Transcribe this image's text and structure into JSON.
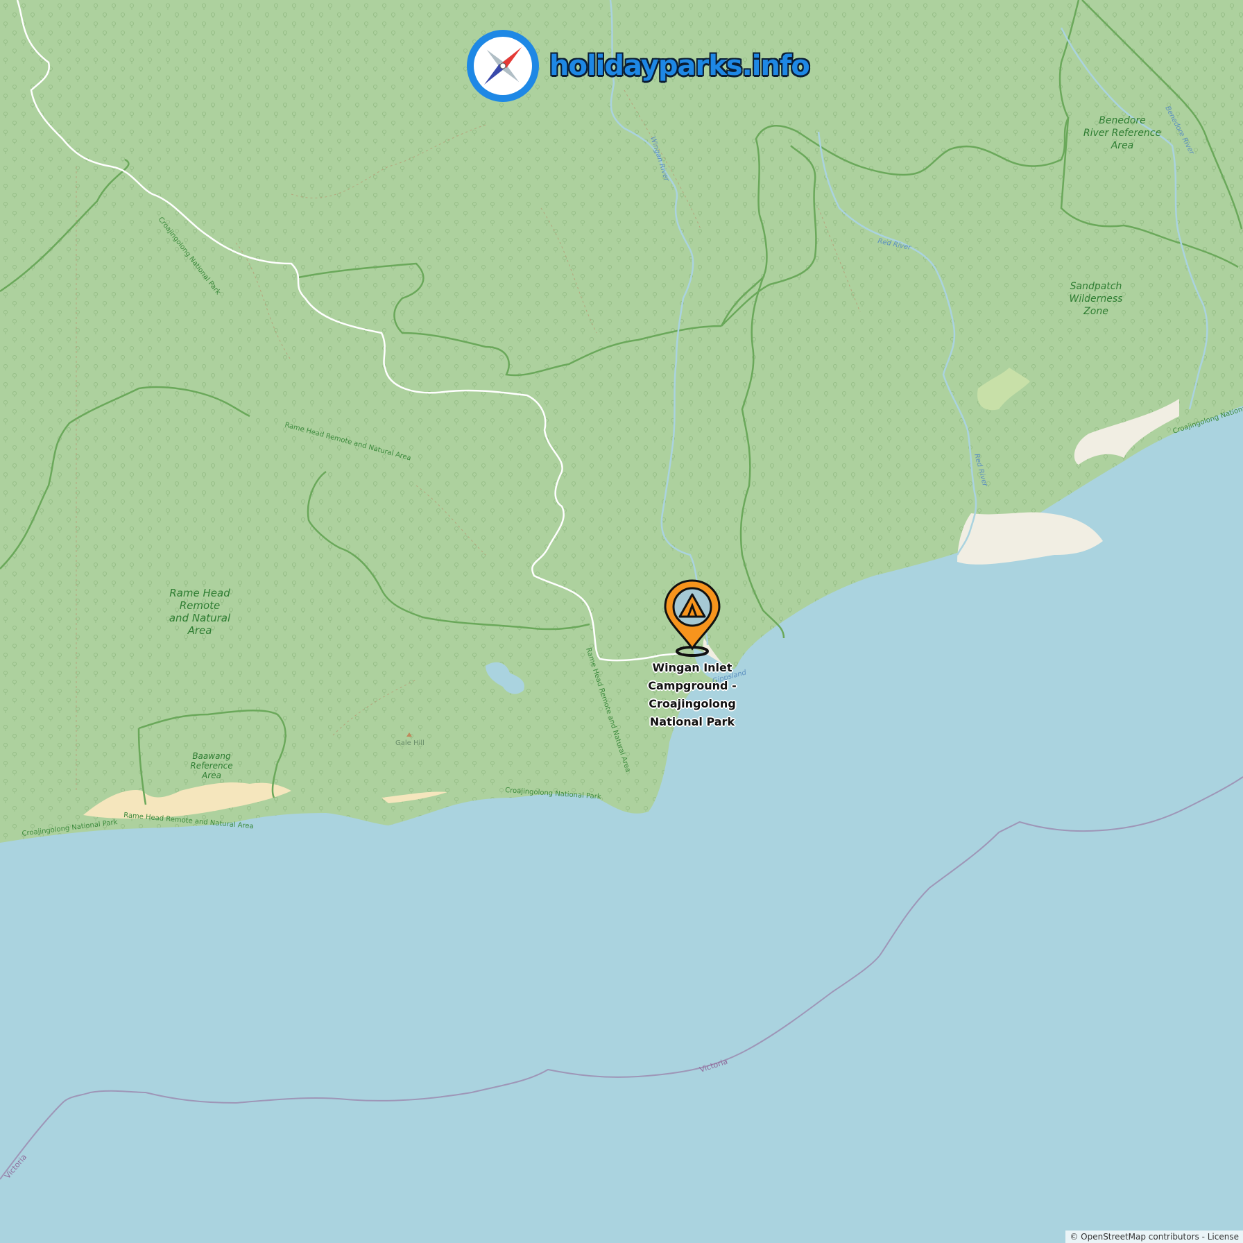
{
  "brand": {
    "name": "holidayparks.info",
    "icon": "compass-icon",
    "color": "#1e88e5"
  },
  "marker": {
    "icon": "tent-pin-icon",
    "color": "#f7941d",
    "label": "Wingan Inlet Campground - Croajingolong National Park"
  },
  "map_labels": {
    "rame_head": [
      "Rame Head",
      "Remote",
      "and Natural",
      "Area"
    ],
    "baawang": [
      "Baawang",
      "Reference",
      "Area"
    ],
    "benedore": [
      "Benedore",
      "River Reference",
      "Area"
    ],
    "sandpatch": [
      "Sandpatch",
      "Wilderness",
      "Zone"
    ],
    "croajingolong_nw": "Croajingolong National Park",
    "croajingolong_coast_w": "Croajingolong National Park",
    "croajingolong_coast_mid": "Croajingolong National Park",
    "croajingolong_coast_e": "Croajingolong National",
    "rame_head_remote_coast": "Rame Head Remote and Natural Area",
    "rame_head_remote_curve": "Rame Head Remote and Natural Area",
    "rame_head_remote_mid": "Rame Head Remote and Natural Area",
    "gale_hill": "Gale Hill",
    "wingan_river": "Wingan River",
    "red_river": "Red River",
    "red_river_south": "Red River",
    "benedore_river": "Benedore River",
    "gippsland": "Gippsland",
    "victoria_1": "Victoria",
    "victoria_2": "Victoria"
  },
  "attribution": {
    "copyright": "© OpenStreetMap contributors",
    "separator": " - ",
    "license": "License"
  },
  "colors": {
    "land": "#add19e",
    "sea": "#aad3df",
    "beach": "#fff1ba",
    "dunes": "#f3eee0",
    "boundary": "#6aa85a",
    "road": "#ffffff",
    "river": "#aad3df",
    "state_border": "#9c8bb0"
  }
}
